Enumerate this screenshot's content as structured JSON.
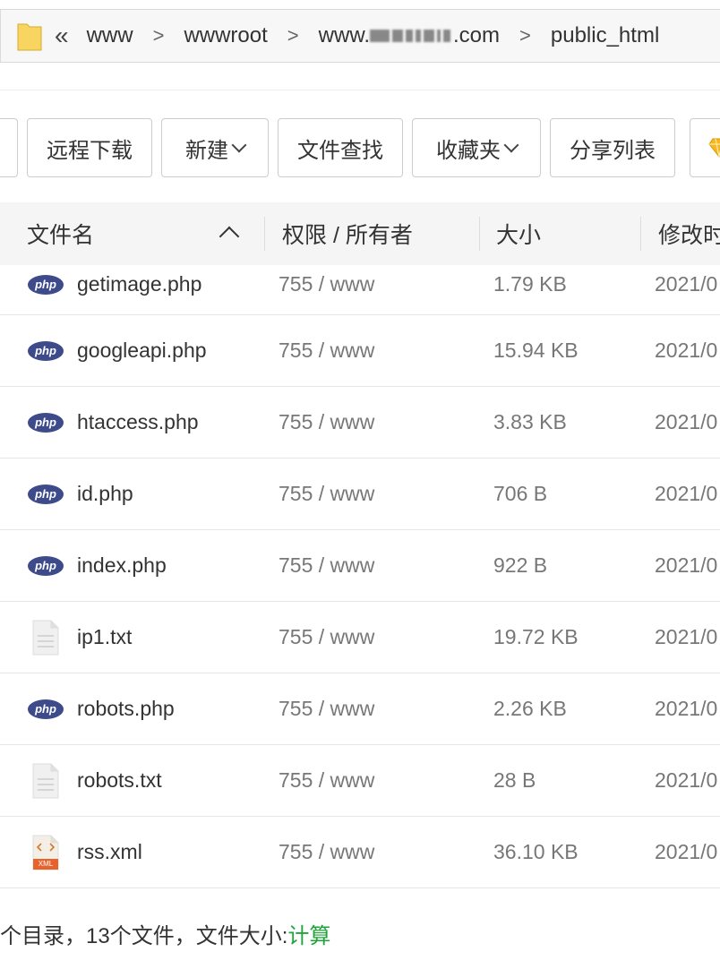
{
  "breadcrumb": {
    "back": "«",
    "items": [
      "www",
      "wwwroot",
      "www.",
      ".com",
      "public_html"
    ],
    "separator": ">"
  },
  "toolbar": {
    "remote_download": "远程下载",
    "new": "新建",
    "file_search": "文件查找",
    "favorites": "收藏夹",
    "share_list": "分享列表"
  },
  "table": {
    "headers": {
      "name": "文件名",
      "permission": "权限 / 所有者",
      "size": "大小",
      "modified": "修改时"
    },
    "rows": [
      {
        "icon": "php-icon",
        "name": "getimage.php",
        "perm": "755 / www",
        "size": "1.79 KB",
        "date": "2021/0"
      },
      {
        "icon": "php-icon",
        "name": "googleapi.php",
        "perm": "755 / www",
        "size": "15.94 KB",
        "date": "2021/0"
      },
      {
        "icon": "php-icon",
        "name": "htaccess.php",
        "perm": "755 / www",
        "size": "3.83 KB",
        "date": "2021/0"
      },
      {
        "icon": "php-icon",
        "name": "id.php",
        "perm": "755 / www",
        "size": "706 B",
        "date": "2021/0"
      },
      {
        "icon": "php-icon",
        "name": "index.php",
        "perm": "755 / www",
        "size": "922 B",
        "date": "2021/0"
      },
      {
        "icon": "txt-icon",
        "name": "ip1.txt",
        "perm": "755 / www",
        "size": "19.72 KB",
        "date": "2021/0"
      },
      {
        "icon": "php-icon",
        "name": "robots.php",
        "perm": "755 / www",
        "size": "2.26 KB",
        "date": "2021/0"
      },
      {
        "icon": "txt-icon",
        "name": "robots.txt",
        "perm": "755 / www",
        "size": "28 B",
        "date": "2021/0"
      },
      {
        "icon": "xml-icon",
        "name": "rss.xml",
        "perm": "755 / www",
        "size": "36.10 KB",
        "date": "2021/0"
      }
    ]
  },
  "footer": {
    "summary": "个目录，13个文件，文件大小: ",
    "calc": "计算"
  },
  "icons": {
    "php_label": "php",
    "xml_label": "XML"
  },
  "colors": {
    "php_icon": "#3e4b8a",
    "calc_link": "#20a53a",
    "folder": "#f7d560"
  }
}
